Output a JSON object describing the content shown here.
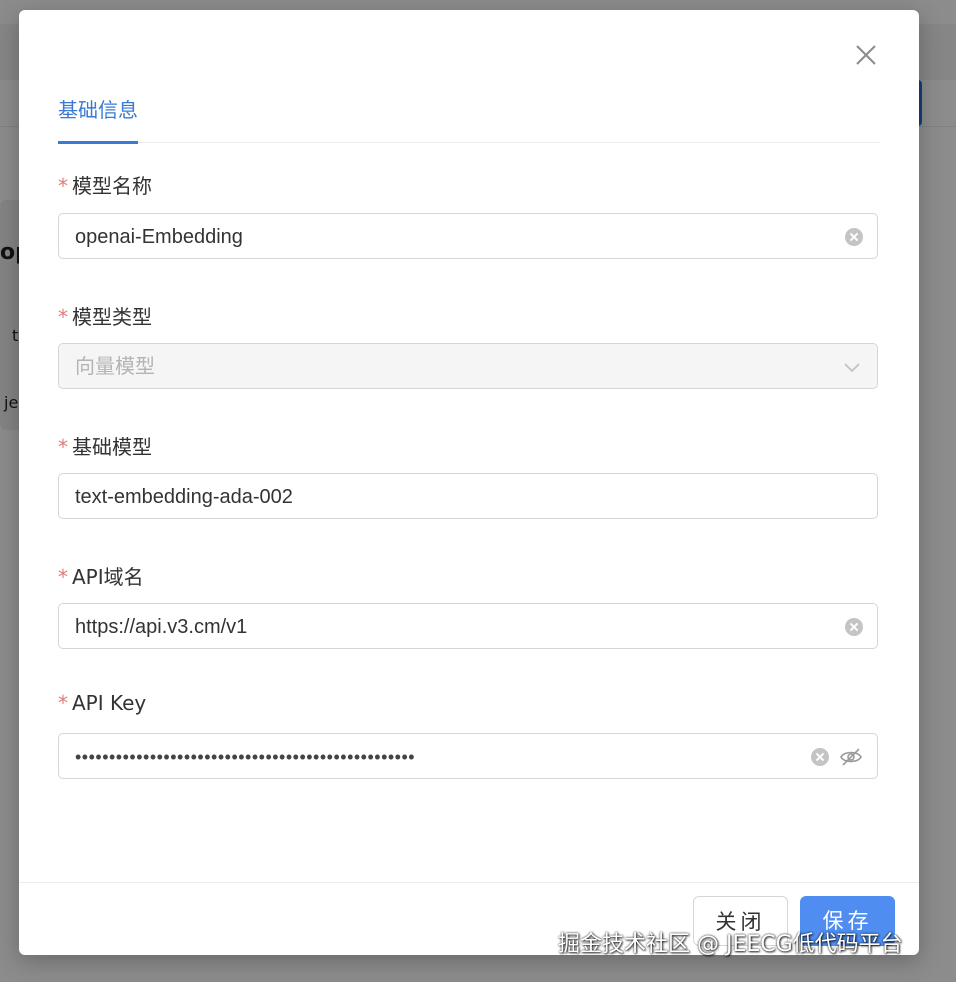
{
  "modal": {
    "tabs": [
      {
        "label": "基础信息",
        "active": true
      }
    ],
    "fields": {
      "model_name": {
        "label": "模型名称",
        "required": true,
        "value": "openai-Embedding"
      },
      "model_type": {
        "label": "模型类型",
        "required": true,
        "value": "向量模型",
        "disabled": true
      },
      "base_model": {
        "label": "基础模型",
        "required": true,
        "value": "text-embedding-ada-002"
      },
      "api_domain": {
        "label": "API域名",
        "required": true,
        "value": "https://api.v3.cm/v1"
      },
      "api_key": {
        "label": "API Key",
        "required": true,
        "value": "••••••••••••••••••••••••••••••••••••••••••••••••••"
      }
    },
    "footer": {
      "close_label": "关闭",
      "save_label": "保存"
    }
  },
  "background": {
    "text_fragments": [
      "op",
      "t",
      "jec"
    ]
  },
  "watermark": "掘金技术社区 @ JEECG低代码平台",
  "colors": {
    "accent": "#3a7ad6",
    "primary_button": "#4f8ef0",
    "required_mark": "#e07b7b"
  }
}
